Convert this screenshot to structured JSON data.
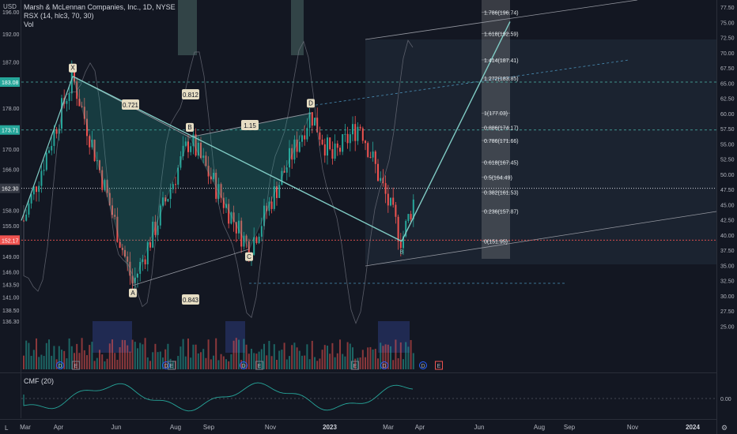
{
  "legend": {
    "symbol": "Marsh & McLennan Companies, Inc., 1D, NYSE",
    "indicator": "RSX (14, hlc3, 70, 30)",
    "volume": "Vol",
    "cmf": "CMF (20)"
  },
  "currency": "USD",
  "colors": {
    "background": "#131722",
    "pattern": "#80cbc4",
    "up": "#26a69a",
    "down": "#ef5350",
    "fib": "#e6ebee",
    "label_bg": "#e6ddc3"
  },
  "chart_data": {
    "type": "candlestick",
    "ylim": [
      135.5,
      197
    ],
    "left_axis_ticks": [
      "196.00",
      "192.00",
      "187.00",
      "183.08",
      "178.00",
      "173.71",
      "170.00",
      "166.00",
      "162.30",
      "158.00",
      "155.00",
      "152.17",
      "149.00",
      "146.00",
      "143.50",
      "141.00",
      "138.50",
      "136.30"
    ],
    "right_axis_ticks": [
      "77.50",
      "75.00",
      "72.50",
      "70.00",
      "67.50",
      "65.00",
      "62.50",
      "60.00",
      "57.50",
      "55.00",
      "52.50",
      "50.00",
      "47.50",
      "45.00",
      "42.50",
      "40.00",
      "37.50",
      "35.00",
      "32.50",
      "30.00",
      "27.50",
      "25.00"
    ],
    "right_axis_values": [
      77.5,
      75,
      72.5,
      70,
      67.5,
      65,
      62.5,
      60,
      57.5,
      55,
      52.5,
      50,
      47.5,
      45,
      42.5,
      40,
      37.5,
      35,
      32.5,
      30,
      27.5,
      25
    ],
    "cmf_tick": "0.00",
    "x_ticks": [
      "Mar",
      "Apr",
      "Jun",
      "Aug",
      "Sep",
      "Nov",
      "2023",
      "Mar",
      "Apr",
      "Jun",
      "Aug",
      "Sep",
      "Nov",
      "2024"
    ],
    "price_tags": [
      {
        "label": "183.08",
        "value": 183.08,
        "color": "#26a69a"
      },
      {
        "label": "173.71",
        "value": 173.71,
        "color": "#26a69a"
      },
      {
        "label": "162.30",
        "value": 162.3,
        "color": "#363a45"
      },
      {
        "label": "152.17",
        "value": 152.17,
        "color": "#ef5350"
      }
    ],
    "pattern_points": [
      {
        "label": "X",
        "value": 184.2
      },
      {
        "label": "A",
        "value": 143.3
      },
      {
        "label": "B",
        "value": 172.3
      },
      {
        "label": "C",
        "value": 150.4
      },
      {
        "label": "D",
        "value": 177.0
      },
      {
        "label": "B",
        "value": 151.95
      }
    ],
    "ratios": [
      "0.721",
      "0.812",
      "1.15",
      "0.843"
    ],
    "fib_levels": [
      {
        "label": "1.786(196.74)",
        "value": 196.74
      },
      {
        "label": "1.618(192.59)",
        "value": 192.59
      },
      {
        "label": "1.414(187.41)",
        "value": 187.41
      },
      {
        "label": "1.272(183.85)",
        "value": 183.85
      },
      {
        "label": "1(177.03)",
        "value": 177.03
      },
      {
        "label": "0.886(174.17)",
        "value": 174.17
      },
      {
        "label": "0.786(171.66)",
        "value": 171.66
      },
      {
        "label": "0.618(167.45)",
        "value": 167.45
      },
      {
        "label": "0.5(164.49)",
        "value": 164.49
      },
      {
        "label": "0.382(161.53)",
        "value": 161.53
      },
      {
        "label": "0.236(157.87)",
        "value": 157.87
      },
      {
        "label": "0(151.95)",
        "value": 151.95
      }
    ],
    "event_markers": [
      "D",
      "E",
      "D",
      "E",
      "D",
      "E",
      "E",
      "D",
      "D",
      "E"
    ],
    "axis_buttons": [
      "L",
      "⚙"
    ]
  }
}
